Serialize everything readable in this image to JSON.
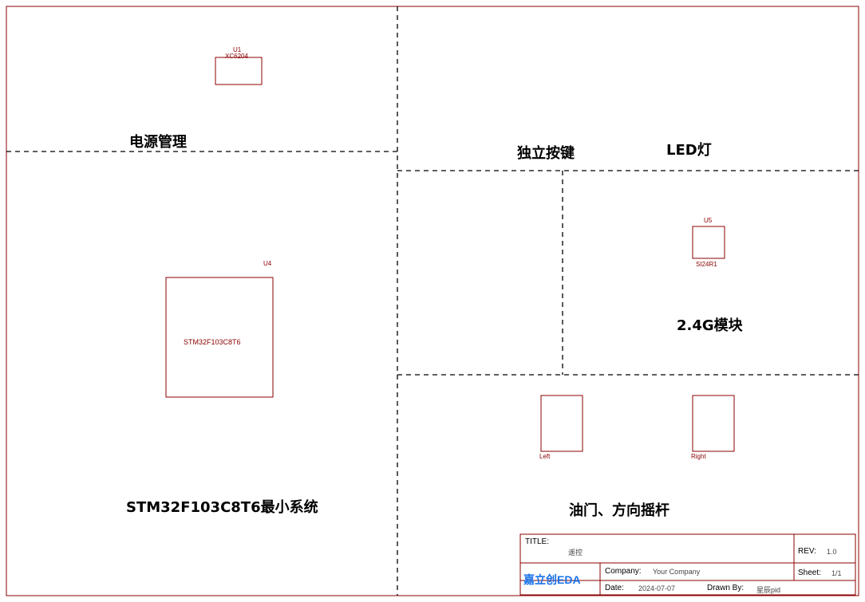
{
  "sections": {
    "power": "电源管理",
    "keys": "独立按键",
    "led": "LED灯",
    "mcu": "STM32F103C8T6最小系统",
    "rf": "2.4G模块",
    "joystick": "油门、方向摇杆"
  },
  "components": {
    "mcu_part": "STM32F103C8T6",
    "mcu_ref": "U4",
    "rf_ref": "U5",
    "rf_part": "SI24R1",
    "ldo_ref": "U1",
    "ldo_part": "XC6204",
    "left_stick": "Left",
    "right_stick": "Right"
  },
  "title_block": {
    "title_label": "TITLE:",
    "title_value": "遥控",
    "rev_label": "REV:",
    "rev_value": "1.0",
    "company_label": "Company:",
    "company_value": "Your Company",
    "sheet_label": "Sheet:",
    "sheet_value": "1/1",
    "date_label": "Date:",
    "date_value": "2024-07-07",
    "drawn_label": "Drawn By:",
    "drawn_value": "星辰pid",
    "logo": "嘉立创EDA"
  }
}
